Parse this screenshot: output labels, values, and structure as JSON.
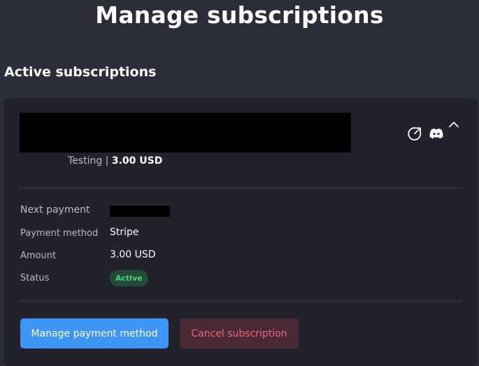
{
  "page": {
    "title": "Manage subscriptions"
  },
  "section": {
    "title": "Active subscriptions"
  },
  "subscription": {
    "plan": "Testing",
    "separator": "|",
    "price": "3.00 USD",
    "details": {
      "next_payment_label": "Next payment",
      "payment_method_label": "Payment method",
      "payment_method_value": "Stripe",
      "amount_label": "Amount",
      "amount_value": "3.00 USD",
      "status_label": "Status",
      "status_value": "Active"
    },
    "icons": [
      "external-link-icon",
      "discord-icon",
      "chevron-up-icon"
    ]
  },
  "actions": {
    "manage_label": "Manage payment method",
    "cancel_label": "Cancel subscription"
  },
  "colors": {
    "background": "#2b2d38",
    "card": "#21222b",
    "primary": "#3d95f5",
    "danger_text": "#f2637d",
    "danger_bg": "#4a2a35",
    "status_green": "#4fd17f"
  }
}
